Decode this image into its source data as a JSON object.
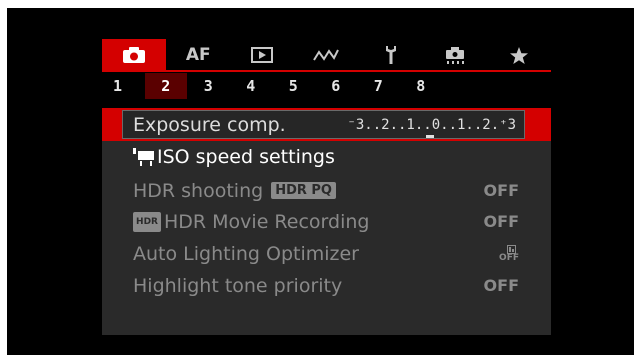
{
  "tabs": [
    {
      "name": "camera-icon",
      "label": ""
    },
    {
      "name": "af",
      "label": "AF"
    },
    {
      "name": "play-icon",
      "label": ""
    },
    {
      "name": "wave-icon",
      "label": ""
    },
    {
      "name": "wrench-icon",
      "label": ""
    },
    {
      "name": "custom-icon",
      "label": ""
    },
    {
      "name": "star-icon",
      "label": ""
    }
  ],
  "pages": [
    "1",
    "2",
    "3",
    "4",
    "5",
    "6",
    "7",
    "8"
  ],
  "active_page": "2",
  "menu": {
    "exposure_comp": {
      "label": "Exposure comp.",
      "scale": "⁻3..2..1..0..1..2.⁺3"
    },
    "iso_speed": {
      "label": "ISO speed settings"
    },
    "hdr_shooting": {
      "label": "HDR shooting",
      "badge": "HDR PQ",
      "value": "OFF"
    },
    "hdr_movie": {
      "icon_text": "HDR",
      "label": "HDR Movie Recording",
      "value": "OFF"
    },
    "auto_lighting": {
      "label": "Auto Lighting Optimizer",
      "value_text": "OFF"
    },
    "highlight_tone": {
      "label": "Highlight tone priority",
      "value": "OFF"
    }
  },
  "colors": {
    "accent": "#d40000",
    "background": "#000000",
    "menu": "#2a2a2a"
  }
}
